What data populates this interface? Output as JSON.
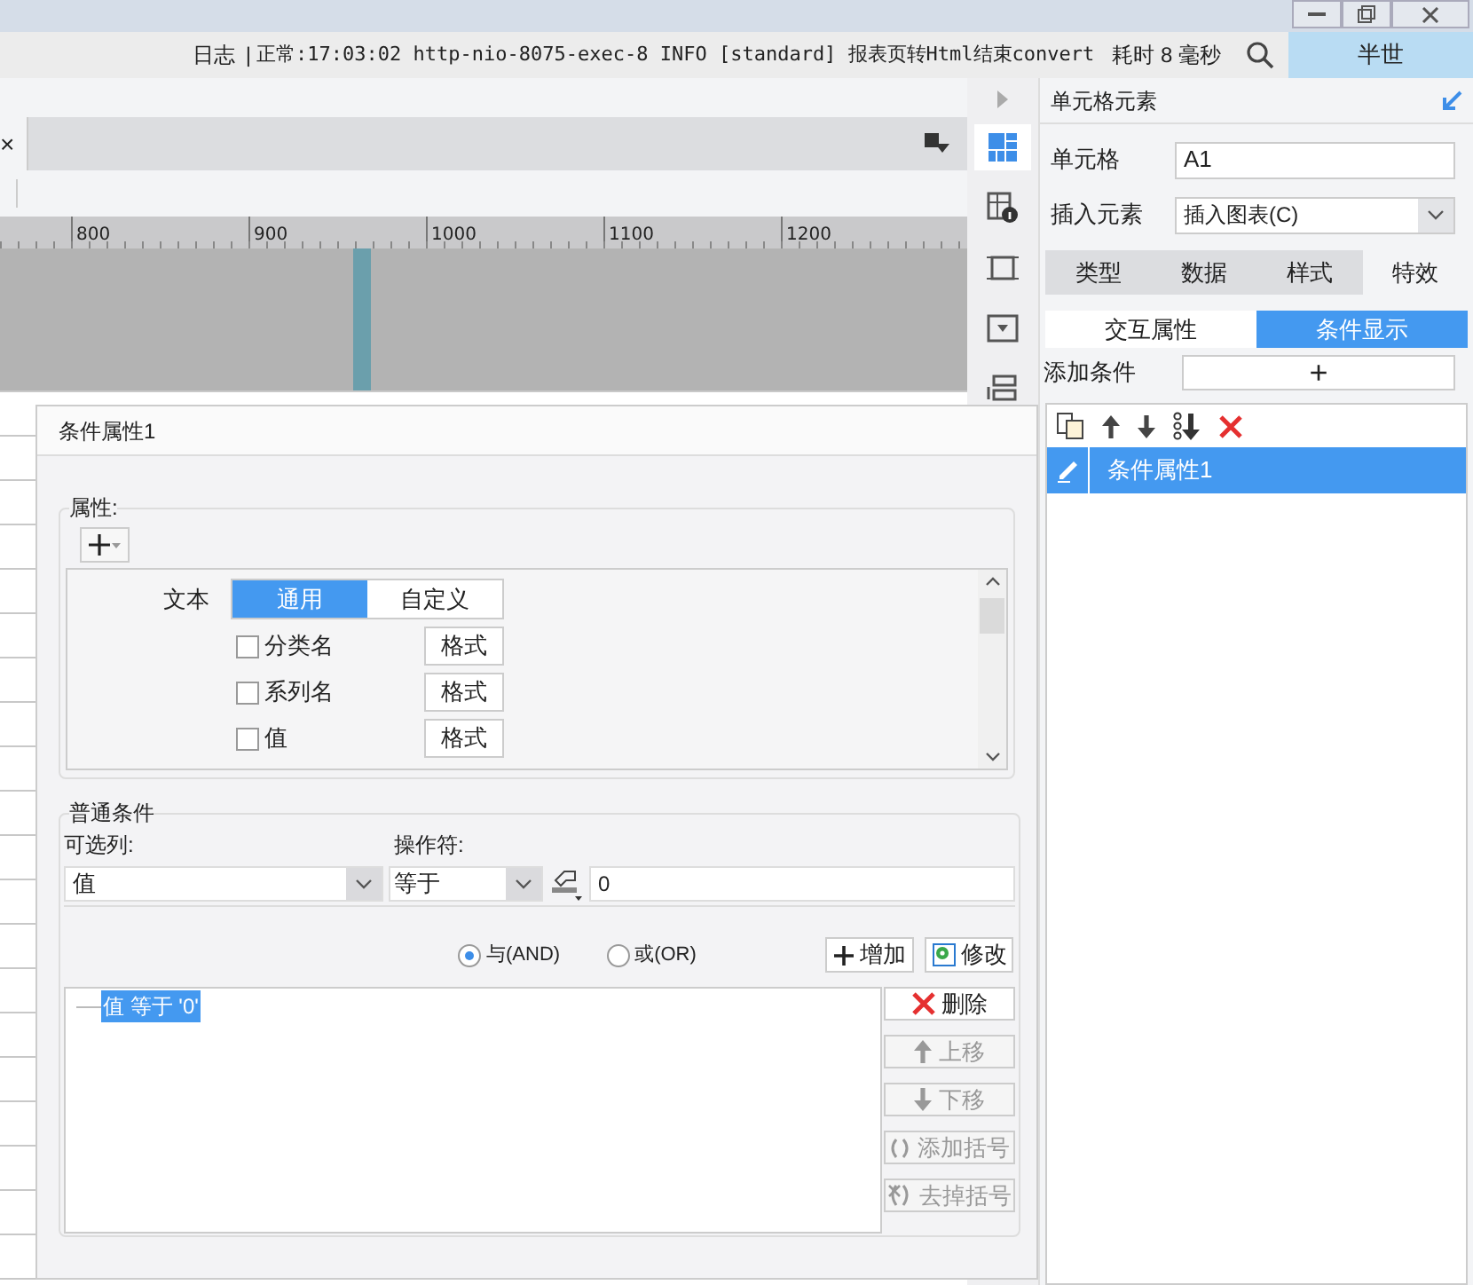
{
  "log_bar": {
    "label": "日志",
    "separator": "|",
    "message": "正常:17:03:02 http-nio-8075-exec-8 INFO [standard] 报表页转Html结束convert",
    "duration": "耗时 8 毫秒",
    "user": "半世"
  },
  "sheet_tab": {
    "close": "×"
  },
  "ruler": {
    "ticks": [
      "800",
      "900",
      "1000",
      "1100",
      "1200"
    ]
  },
  "tool_icons": [
    {
      "kind": "cell",
      "selected": true
    },
    {
      "kind": "cell-info",
      "selected": false
    },
    {
      "kind": "frame",
      "selected": false
    },
    {
      "kind": "widget",
      "selected": false
    },
    {
      "kind": "stack",
      "selected": false
    }
  ],
  "cell_panel": {
    "title": "单元格元素",
    "cell_label": "单元格",
    "cell_value": "A1",
    "insert_label": "插入元素",
    "insert_value": "插入图表(C)",
    "tabs": [
      {
        "label": "类型",
        "selected": false
      },
      {
        "label": "数据",
        "selected": false
      },
      {
        "label": "样式",
        "selected": false
      },
      {
        "label": "特效",
        "selected": true
      }
    ],
    "subtabs": [
      {
        "label": "交互属性",
        "selected": false
      },
      {
        "label": "条件显示",
        "selected": true
      }
    ],
    "add_label": "添加条件",
    "add_button": "+",
    "conditions": [
      {
        "label": "条件属性1",
        "selected": true
      }
    ]
  },
  "dialog": {
    "title": "条件属性1",
    "attributes": {
      "legend": "属性:",
      "text_label": "文本",
      "modes": [
        {
          "label": "通用",
          "selected": true
        },
        {
          "label": "自定义",
          "selected": false
        }
      ],
      "items": [
        {
          "label": "分类名",
          "checked": false,
          "button": "格式"
        },
        {
          "label": "系列名",
          "checked": false,
          "button": "格式"
        },
        {
          "label": "值",
          "checked": false,
          "button": "格式"
        }
      ]
    },
    "conditions": {
      "legend": "普通条件",
      "column_label": "可选列:",
      "operator_label": "操作符:",
      "column_value": "值",
      "operator_value": "等于",
      "value": "0",
      "logic": [
        {
          "label": "与(AND)",
          "selected": true
        },
        {
          "label": "或(OR)",
          "selected": false
        }
      ],
      "add": "增加",
      "modify": "修改",
      "items": [
        {
          "label": "值 等于 '0'",
          "selected": true
        }
      ],
      "actions": [
        {
          "kind": "delete",
          "label": "删除",
          "disabled": false
        },
        {
          "kind": "up",
          "label": "上移",
          "disabled": true
        },
        {
          "kind": "down",
          "label": "下移",
          "disabled": true
        },
        {
          "kind": "add-paren",
          "label": "添加括号",
          "disabled": true
        },
        {
          "kind": "remove-paren",
          "label": "去掉括号",
          "disabled": true
        }
      ]
    }
  }
}
